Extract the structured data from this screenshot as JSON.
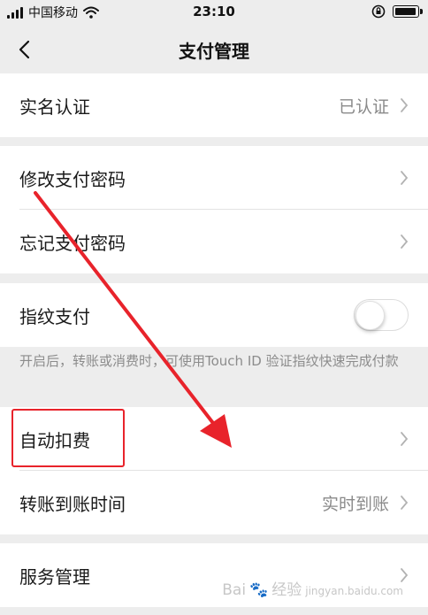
{
  "status_bar": {
    "carrier": "中国移动",
    "time": "23:10"
  },
  "nav": {
    "title": "支付管理"
  },
  "rows": {
    "realname": {
      "label": "实名认证",
      "value": "已认证"
    },
    "change_password": {
      "label": "修改支付密码"
    },
    "forgot_password": {
      "label": "忘记支付密码"
    },
    "fingerprint": {
      "label": "指纹支付",
      "enabled": false
    },
    "auto_deduct": {
      "label": "自动扣费"
    },
    "transfer_time": {
      "label": "转账到账时间",
      "value": "实时到账"
    },
    "service_manage": {
      "label": "服务管理"
    }
  },
  "fingerprint_note": "开启后，转账或消费时，可使用Touch ID 验证指纹快速完成付款",
  "watermark": {
    "text": "Bai",
    "text2": "经验",
    "small": "jingyan.baidu.com"
  },
  "colors": {
    "annotation_red": "#e8232b",
    "background": "#ededed"
  },
  "icons": [
    "back-chevron-icon",
    "chevron-right-icon",
    "wifi-icon",
    "signal-icon",
    "battery-icon",
    "orientation-lock-icon"
  ]
}
